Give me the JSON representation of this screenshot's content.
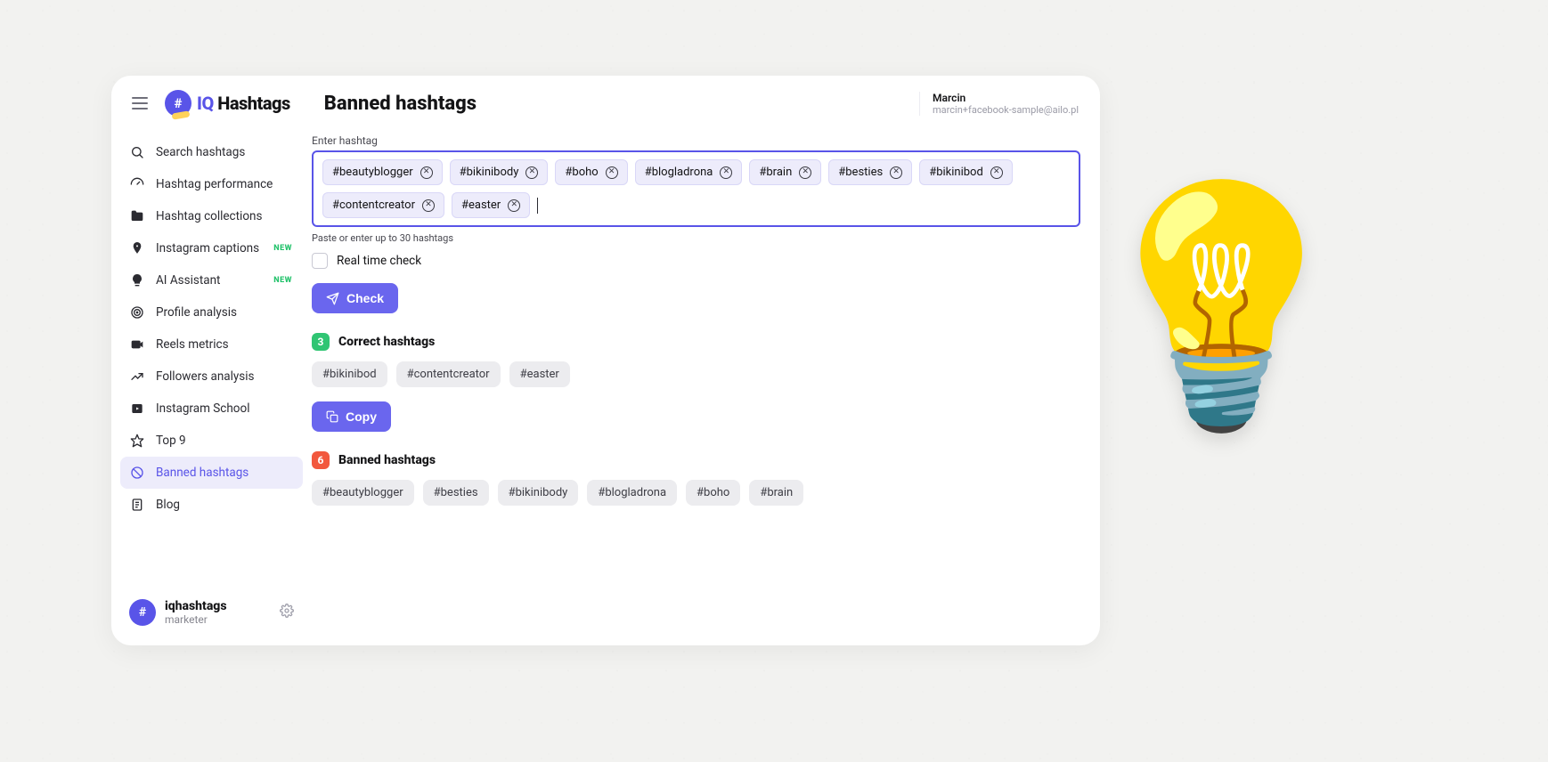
{
  "brand": {
    "iq": "IQ",
    "name": "Hashtags",
    "hash": "#"
  },
  "page_title": "Banned hashtags",
  "user": {
    "name": "Marcin",
    "email": "marcin+facebook-sample@ailo.pl"
  },
  "sidebar": {
    "items": [
      {
        "label": "Search hashtags",
        "icon": "search-icon",
        "new": false,
        "active": false
      },
      {
        "label": "Hashtag performance",
        "icon": "gauge-icon",
        "new": false,
        "active": false
      },
      {
        "label": "Hashtag collections",
        "icon": "folder-icon",
        "new": false,
        "active": false
      },
      {
        "label": "Instagram captions",
        "icon": "pin-icon",
        "new": true,
        "active": false
      },
      {
        "label": "AI Assistant",
        "icon": "bulb-icon",
        "new": true,
        "active": false
      },
      {
        "label": "Profile analysis",
        "icon": "target-icon",
        "new": false,
        "active": false
      },
      {
        "label": "Reels metrics",
        "icon": "video-icon",
        "new": false,
        "active": false
      },
      {
        "label": "Followers analysis",
        "icon": "trend-icon",
        "new": false,
        "active": false
      },
      {
        "label": "Instagram School",
        "icon": "school-icon",
        "new": false,
        "active": false
      },
      {
        "label": "Top 9",
        "icon": "star-icon",
        "new": false,
        "active": false
      },
      {
        "label": "Banned hashtags",
        "icon": "ban-icon",
        "new": false,
        "active": true
      },
      {
        "label": "Blog",
        "icon": "doc-icon",
        "new": false,
        "active": false
      }
    ],
    "new_badge_text": "NEW",
    "account": {
      "handle": "iqhashtags",
      "role": "marketer",
      "avatar_symbol": "#"
    }
  },
  "input": {
    "label": "Enter hashtag",
    "helper": "Paste or enter up to 30 hashtags",
    "tags": [
      "#beautyblogger",
      "#bikinibody",
      "#boho",
      "#blogladrona",
      "#brain",
      "#besties",
      "#bikinibod",
      "#contentcreator",
      "#easter"
    ]
  },
  "realtime": {
    "label": "Real time check",
    "checked": false
  },
  "actions": {
    "check_label": "Check",
    "copy_label": "Copy"
  },
  "results": {
    "correct": {
      "title": "Correct hashtags",
      "count": "3",
      "items": [
        "#bikinibod",
        "#contentcreator",
        "#easter"
      ]
    },
    "banned": {
      "title": "Banned hashtags",
      "count": "6",
      "items": [
        "#beautyblogger",
        "#besties",
        "#bikinibody",
        "#blogladrona",
        "#boho",
        "#brain"
      ]
    }
  },
  "decor": {
    "bulb_emoji": "💡"
  }
}
